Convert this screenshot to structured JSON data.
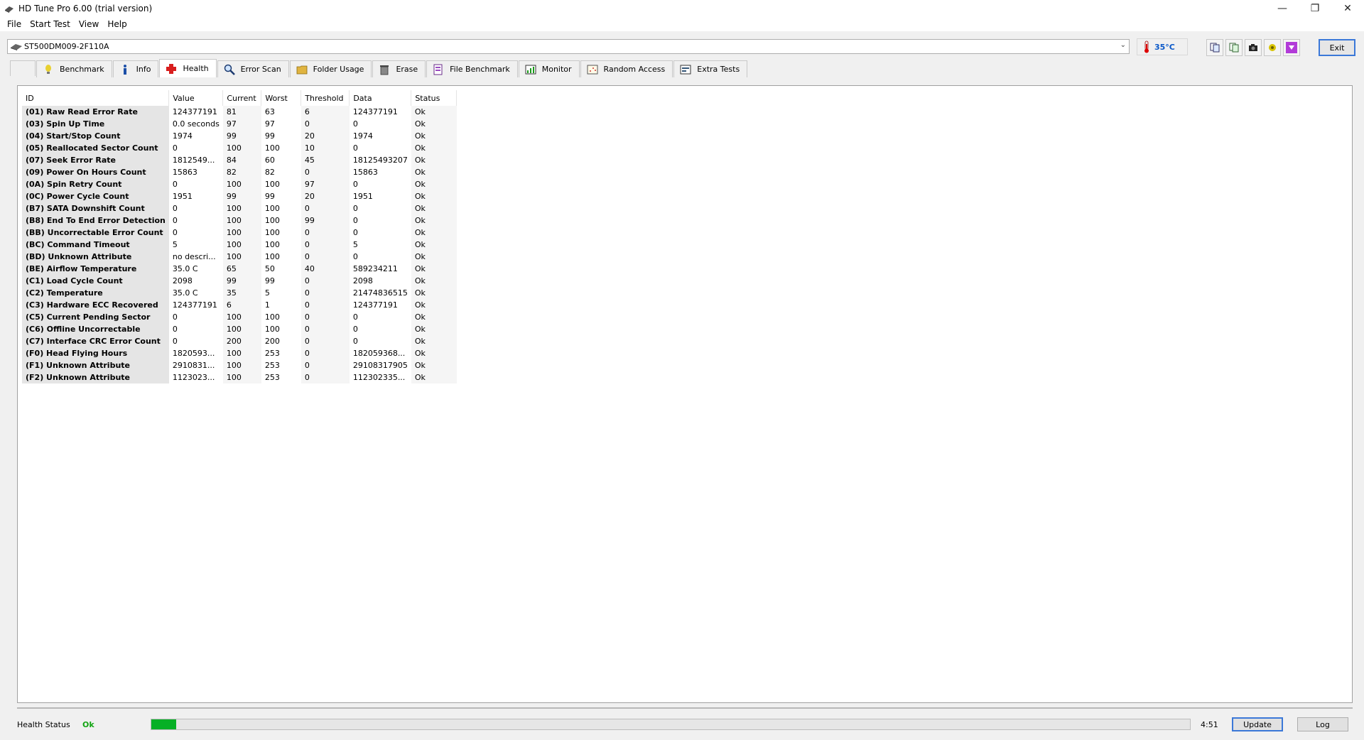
{
  "window": {
    "title": "HD Tune Pro 6.00 (trial version)"
  },
  "menu": [
    "File",
    "Start Test",
    "View",
    "Help"
  ],
  "drive": {
    "name": "ST500DM009-2F110A"
  },
  "temperature": "35°C",
  "exit_label": "Exit",
  "tabs": [
    {
      "label": "Benchmark",
      "icon": "bulb-icon"
    },
    {
      "label": "Info",
      "icon": "info-icon"
    },
    {
      "label": "Health",
      "icon": "health-cross-icon"
    },
    {
      "label": "Error Scan",
      "icon": "magnifier-icon"
    },
    {
      "label": "Folder Usage",
      "icon": "folder-icon"
    },
    {
      "label": "Erase",
      "icon": "trash-icon"
    },
    {
      "label": "File Benchmark",
      "icon": "file-benchmark-icon"
    },
    {
      "label": "Monitor",
      "icon": "monitor-icon"
    },
    {
      "label": "Random Access",
      "icon": "random-access-icon"
    },
    {
      "label": "Extra Tests",
      "icon": "extra-tests-icon"
    }
  ],
  "active_tab": "Health",
  "table": {
    "columns": [
      "ID",
      "Value",
      "Current",
      "Worst",
      "Threshold",
      "Data",
      "Status"
    ],
    "rows": [
      [
        "(01) Raw Read Error Rate",
        "124377191",
        "81",
        "63",
        "6",
        "124377191",
        "Ok"
      ],
      [
        "(03) Spin Up Time",
        "0.0 seconds",
        "97",
        "97",
        "0",
        "0",
        "Ok"
      ],
      [
        "(04) Start/Stop Count",
        "1974",
        "99",
        "99",
        "20",
        "1974",
        "Ok"
      ],
      [
        "(05) Reallocated Sector Count",
        "0",
        "100",
        "100",
        "10",
        "0",
        "Ok"
      ],
      [
        "(07) Seek Error Rate",
        "1812549...",
        "84",
        "60",
        "45",
        "18125493207",
        "Ok"
      ],
      [
        "(09) Power On Hours Count",
        "15863",
        "82",
        "82",
        "0",
        "15863",
        "Ok"
      ],
      [
        "(0A) Spin Retry Count",
        "0",
        "100",
        "100",
        "97",
        "0",
        "Ok"
      ],
      [
        "(0C) Power Cycle Count",
        "1951",
        "99",
        "99",
        "20",
        "1951",
        "Ok"
      ],
      [
        "(B7) SATA Downshift Count",
        "0",
        "100",
        "100",
        "0",
        "0",
        "Ok"
      ],
      [
        "(B8) End To End Error Detection",
        "0",
        "100",
        "100",
        "99",
        "0",
        "Ok"
      ],
      [
        "(BB) Uncorrectable Error Count",
        "0",
        "100",
        "100",
        "0",
        "0",
        "Ok"
      ],
      [
        "(BC) Command Timeout",
        "5",
        "100",
        "100",
        "0",
        "5",
        "Ok"
      ],
      [
        "(BD) Unknown Attribute",
        "no descri...",
        "100",
        "100",
        "0",
        "0",
        "Ok"
      ],
      [
        "(BE) Airflow Temperature",
        "35.0 C",
        "65",
        "50",
        "40",
        "589234211",
        "Ok"
      ],
      [
        "(C1) Load Cycle Count",
        "2098",
        "99",
        "99",
        "0",
        "2098",
        "Ok"
      ],
      [
        "(C2) Temperature",
        "35.0 C",
        "35",
        "5",
        "0",
        "21474836515",
        "Ok"
      ],
      [
        "(C3) Hardware ECC Recovered",
        "124377191",
        "6",
        "1",
        "0",
        "124377191",
        "Ok"
      ],
      [
        "(C5) Current Pending Sector",
        "0",
        "100",
        "100",
        "0",
        "0",
        "Ok"
      ],
      [
        "(C6) Offline Uncorrectable",
        "0",
        "100",
        "100",
        "0",
        "0",
        "Ok"
      ],
      [
        "(C7) Interface CRC Error Count",
        "0",
        "200",
        "200",
        "0",
        "0",
        "Ok"
      ],
      [
        "(F0) Head Flying Hours",
        "1820593...",
        "100",
        "253",
        "0",
        "182059368...",
        "Ok"
      ],
      [
        "(F1) Unknown Attribute",
        "2910831...",
        "100",
        "253",
        "0",
        "29108317905",
        "Ok"
      ],
      [
        "(F2) Unknown Attribute",
        "1123023...",
        "100",
        "253",
        "0",
        "112302335...",
        "Ok"
      ]
    ]
  },
  "status": {
    "label": "Health Status",
    "value": "Ok",
    "progress_fraction": 0.024,
    "time": "4:51",
    "update_label": "Update",
    "log_label": "Log"
  },
  "colors": {
    "accent": "#3b78d8",
    "ok_green": "#13a513",
    "progress_green": "#06b025",
    "temp_blue": "#0a58c8"
  }
}
